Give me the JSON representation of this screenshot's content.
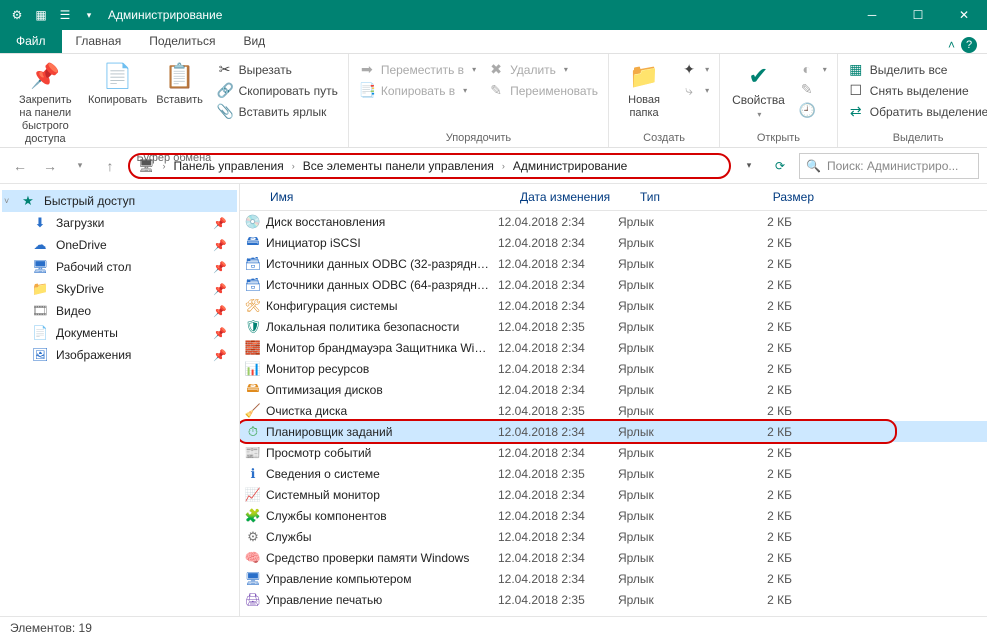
{
  "titlebar": {
    "title": "Администрирование"
  },
  "tabs": {
    "file": "Файл",
    "t1": "Главная",
    "t2": "Поделиться",
    "t3": "Вид"
  },
  "ribbon": {
    "g1": {
      "label": "Буфер обмена",
      "pin": "Закрепить на панели\nбыстрого доступа",
      "copy": "Копировать",
      "paste": "Вставить",
      "cut": "Вырезать",
      "copypath": "Скопировать путь",
      "pastesc": "Вставить ярлык"
    },
    "g2": {
      "label": "Упорядочить",
      "moveto": "Переместить в",
      "copyto": "Копировать в",
      "delete": "Удалить",
      "rename": "Переименовать"
    },
    "g3": {
      "label": "Создать",
      "newfolder": "Новая\nпапка"
    },
    "g4": {
      "label": "Открыть",
      "props": "Свойства"
    },
    "g5": {
      "label": "Выделить",
      "selectall": "Выделить все",
      "selectnone": "Снять выделение",
      "invert": "Обратить выделение"
    }
  },
  "breadcrumb": {
    "c1": "Панель управления",
    "c2": "Все элементы панели управления",
    "c3": "Администрирование"
  },
  "search": {
    "placeholder": "Поиск: Администриро..."
  },
  "sidebar": {
    "items": [
      {
        "label": "Быстрый доступ",
        "icon": "★",
        "cls": "i-teal",
        "pin": false,
        "active": true,
        "exp": true
      },
      {
        "label": "Загрузки",
        "icon": "⬇",
        "cls": "i-blue",
        "pin": true
      },
      {
        "label": "OneDrive",
        "icon": "☁",
        "cls": "i-blue",
        "pin": true
      },
      {
        "label": "Рабочий стол",
        "icon": "🖥",
        "cls": "i-blue",
        "pin": true
      },
      {
        "label": "SkyDrive",
        "icon": "📁",
        "cls": "i-orange",
        "pin": true
      },
      {
        "label": "Видео",
        "icon": "🎞",
        "cls": "i-gray",
        "pin": true
      },
      {
        "label": "Документы",
        "icon": "📄",
        "cls": "i-gray",
        "pin": true
      },
      {
        "label": "Изображения",
        "icon": "🖼",
        "cls": "i-blue",
        "pin": true
      }
    ]
  },
  "columns": {
    "name": "Имя",
    "date": "Дата изменения",
    "type": "Тип",
    "size": "Размер"
  },
  "files": [
    {
      "icon": "💿",
      "cls": "i-green",
      "name": "Диск восстановления",
      "date": "12.04.2018 2:34",
      "type": "Ярлык",
      "size": "2 КБ"
    },
    {
      "icon": "🖴",
      "cls": "i-blue",
      "name": "Инициатор iSCSI",
      "date": "12.04.2018 2:34",
      "type": "Ярлык",
      "size": "2 КБ"
    },
    {
      "icon": "🗃",
      "cls": "i-blue",
      "name": "Источники данных ODBC (32-разрядна...",
      "date": "12.04.2018 2:34",
      "type": "Ярлык",
      "size": "2 КБ"
    },
    {
      "icon": "🗃",
      "cls": "i-blue",
      "name": "Источники данных ODBC (64-разрядна...",
      "date": "12.04.2018 2:34",
      "type": "Ярлык",
      "size": "2 КБ"
    },
    {
      "icon": "🛠",
      "cls": "i-orange",
      "name": "Конфигурация системы",
      "date": "12.04.2018 2:34",
      "type": "Ярлык",
      "size": "2 КБ"
    },
    {
      "icon": "🛡",
      "cls": "i-teal",
      "name": "Локальная политика безопасности",
      "date": "12.04.2018 2:35",
      "type": "Ярлык",
      "size": "2 КБ"
    },
    {
      "icon": "🧱",
      "cls": "i-red",
      "name": "Монитор брандмауэра Защитника Win...",
      "date": "12.04.2018 2:34",
      "type": "Ярлык",
      "size": "2 КБ"
    },
    {
      "icon": "📊",
      "cls": "i-green",
      "name": "Монитор ресурсов",
      "date": "12.04.2018 2:34",
      "type": "Ярлык",
      "size": "2 КБ"
    },
    {
      "icon": "🖴",
      "cls": "i-orange",
      "name": "Оптимизация дисков",
      "date": "12.04.2018 2:34",
      "type": "Ярлык",
      "size": "2 КБ"
    },
    {
      "icon": "🧹",
      "cls": "i-blue",
      "name": "Очистка диска",
      "date": "12.04.2018 2:35",
      "type": "Ярлык",
      "size": "2 КБ"
    },
    {
      "icon": "⏱",
      "cls": "i-green",
      "name": "Планировщик заданий",
      "date": "12.04.2018 2:34",
      "type": "Ярлык",
      "size": "2 КБ",
      "highlight": true
    },
    {
      "icon": "📰",
      "cls": "i-orange",
      "name": "Просмотр событий",
      "date": "12.04.2018 2:34",
      "type": "Ярлык",
      "size": "2 КБ"
    },
    {
      "icon": "ℹ",
      "cls": "i-blue",
      "name": "Сведения о системе",
      "date": "12.04.2018 2:35",
      "type": "Ярлык",
      "size": "2 КБ"
    },
    {
      "icon": "📈",
      "cls": "i-green",
      "name": "Системный монитор",
      "date": "12.04.2018 2:34",
      "type": "Ярлык",
      "size": "2 КБ"
    },
    {
      "icon": "🧩",
      "cls": "i-yellow",
      "name": "Службы компонентов",
      "date": "12.04.2018 2:34",
      "type": "Ярлык",
      "size": "2 КБ"
    },
    {
      "icon": "⚙",
      "cls": "i-gray",
      "name": "Службы",
      "date": "12.04.2018 2:34",
      "type": "Ярлык",
      "size": "2 КБ"
    },
    {
      "icon": "🧠",
      "cls": "i-blue",
      "name": "Средство проверки памяти Windows",
      "date": "12.04.2018 2:34",
      "type": "Ярлык",
      "size": "2 КБ"
    },
    {
      "icon": "🖥",
      "cls": "i-blue",
      "name": "Управление компьютером",
      "date": "12.04.2018 2:34",
      "type": "Ярлык",
      "size": "2 КБ"
    },
    {
      "icon": "🖨",
      "cls": "i-purple",
      "name": "Управление печатью",
      "date": "12.04.2018 2:35",
      "type": "Ярлык",
      "size": "2 КБ"
    }
  ],
  "status": {
    "text": "Элементов: 19"
  }
}
